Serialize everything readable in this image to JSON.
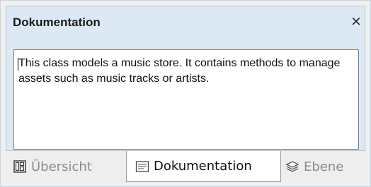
{
  "window": {
    "title": "Dokumentation",
    "close_glyph": "×"
  },
  "documentation": {
    "text": "This class models a music store. It contains methods to manage assets such as music tracks or artists."
  },
  "tabs": [
    {
      "label": "Übersicht",
      "icon": "overview-icon",
      "active": false
    },
    {
      "label": "Dokumentation",
      "icon": "documentation-icon",
      "active": true
    },
    {
      "label": "Ebene",
      "icon": "layers-icon",
      "active": false
    }
  ],
  "colors": {
    "panel_bg": "#dce8f3",
    "text_area_bg": "#ffffff",
    "inactive_tab_text": "#8c8c8c"
  }
}
